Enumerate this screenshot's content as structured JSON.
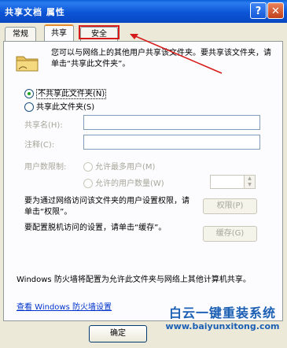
{
  "window": {
    "title": "共享文档 属性",
    "help_label": "?",
    "close_label": "✕"
  },
  "tabs": [
    {
      "label": "常规",
      "active": false
    },
    {
      "label": "共享",
      "active": true
    },
    {
      "label": "安全",
      "active": false
    }
  ],
  "sharing": {
    "description": "您可以与网络上的其他用户共享该文件夹。要共享该文件夹，请单击“共享此文件夹”。",
    "radio_no_share": {
      "label": "不共享此文件夹(N)",
      "checked": true
    },
    "radio_share": {
      "label": "共享此文件夹(S)",
      "checked": false
    },
    "share_name_label": "共享名(H):",
    "comment_label": "注释(C):",
    "user_limit_label": "用户数限制:",
    "max_users_label": "允许最多用户(M)",
    "allow_users_label": "允许的用户数量(W)",
    "permissions_text": "要为通过网络访问该文件夹的用户设置权限，请单击“权限”。",
    "permissions_button": "权限(P)",
    "cache_text": "要配置脱机访问的设置，请单击“缓存”。",
    "cache_button": "缓存(G)",
    "firewall_text": "Windows 防火墙将配置为允许此文件夹与网络上其他计算机共享。",
    "firewall_link": "查看 Windows 防火墙设置"
  },
  "footer": {
    "ok_label": "确定"
  },
  "watermark": {
    "line1": "白云一键重装系统",
    "line2": "www.baiyunxitong.com"
  },
  "annotation": {
    "color": "#d61b1b"
  }
}
